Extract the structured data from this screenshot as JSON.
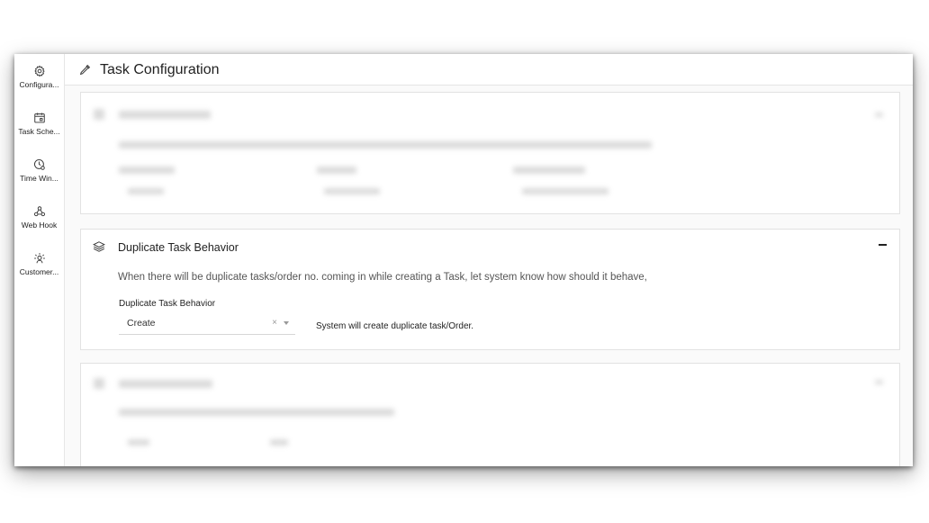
{
  "header": {
    "title": "Task Configuration"
  },
  "sidebar": {
    "items": [
      {
        "label": "Configura...",
        "icon": "gear-icon"
      },
      {
        "label": "Task Sche...",
        "icon": "calendar-icon"
      },
      {
        "label": "Time Win...",
        "icon": "clock-icon"
      },
      {
        "label": "Web Hook",
        "icon": "webhook-icon"
      },
      {
        "label": "Customer...",
        "icon": "customer-idea-icon"
      }
    ]
  },
  "duplicate_section": {
    "title": "Duplicate Task Behavior",
    "description": "When there will be duplicate tasks/order no. coming in while creating a Task, let system know how should it behave,",
    "field_label": "Duplicate Task Behavior",
    "selected_value": "Create",
    "clear_symbol": "×",
    "hint": "System will create duplicate task/Order."
  },
  "colors": {
    "accent": "#222222",
    "border": "#e2e2e2",
    "muted": "#555555"
  }
}
